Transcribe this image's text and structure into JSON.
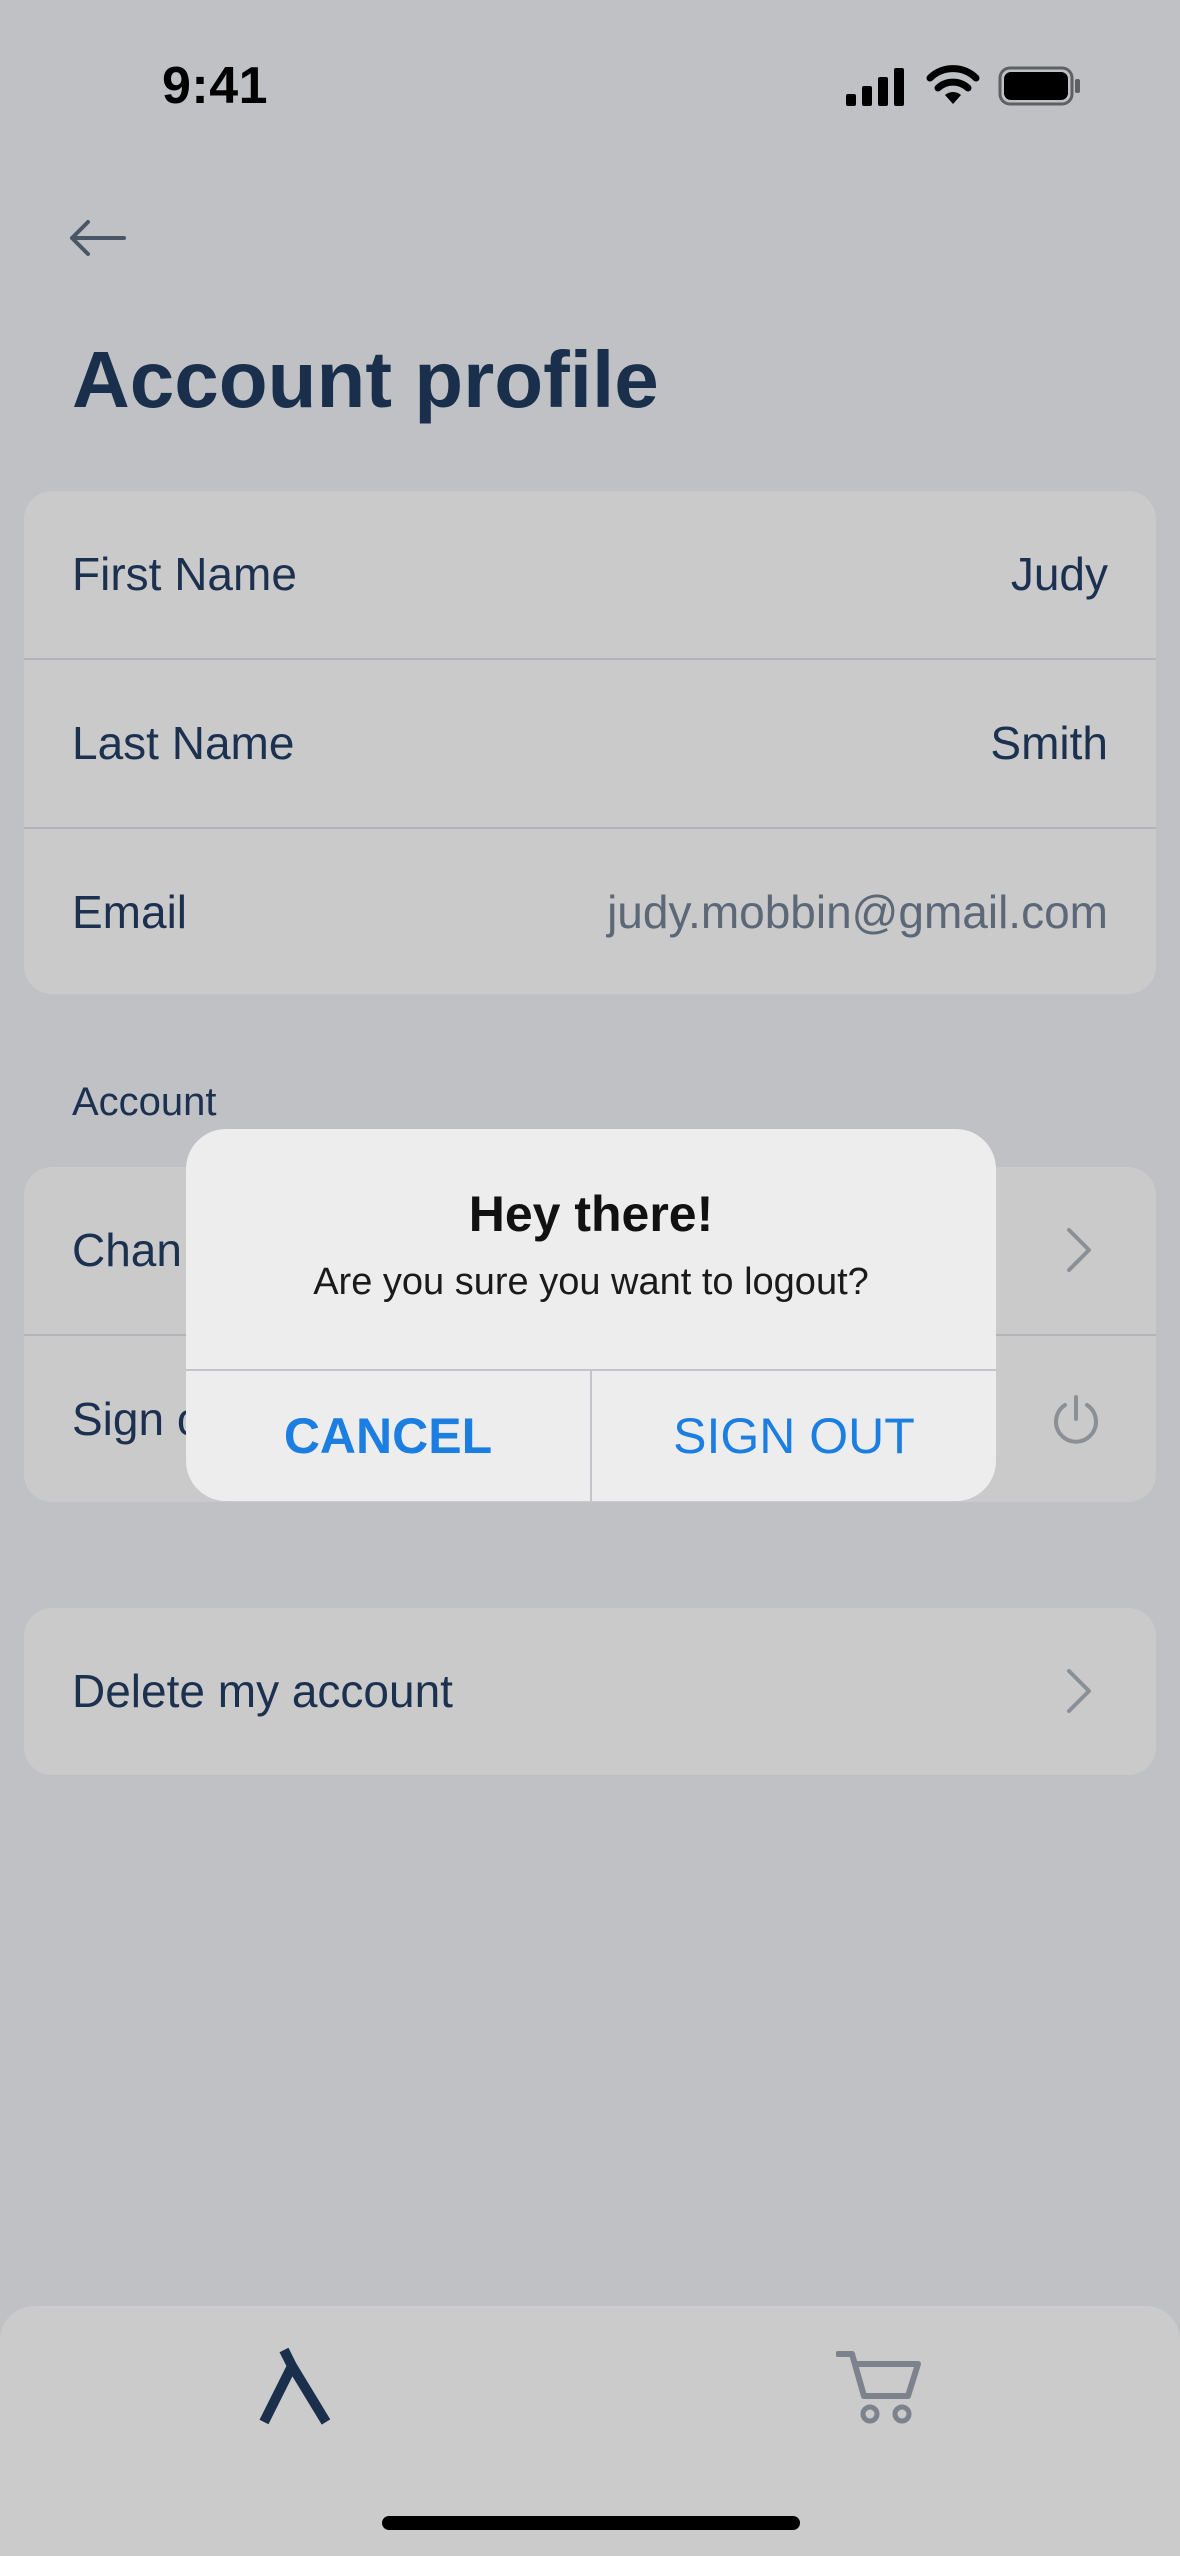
{
  "status_bar": {
    "time": "9:41",
    "icons": [
      "cellular-signal-icon",
      "wifi-icon",
      "battery-icon"
    ]
  },
  "header": {
    "back_icon": "arrow-left-icon",
    "title": "Account profile"
  },
  "profile": {
    "first_name_label": "First Name",
    "first_name_value": "Judy",
    "last_name_label": "Last Name",
    "last_name_value": "Smith",
    "email_label": "Email",
    "email_value": "judy.mobbin@gmail.com"
  },
  "account_section": {
    "label": "Account",
    "change_password_label": "Chan",
    "sign_out_label": "Sign o",
    "sign_out_icon": "power-icon",
    "chevron_icon": "chevron-right-icon"
  },
  "delete_section": {
    "delete_label": "Delete my account",
    "chevron_icon": "chevron-right-icon"
  },
  "dialog": {
    "title": "Hey there!",
    "message": "Are you sure you want to logout?",
    "cancel_label": "CANCEL",
    "sign_out_label": "SIGN OUT"
  },
  "tab_bar": {
    "items": [
      "lambda-icon",
      "cart-icon"
    ]
  },
  "colors": {
    "background": "#bfc1c5",
    "card": "#cacacb",
    "text_primary": "#1c3150",
    "text_muted": "#5c6878",
    "accent": "#1b7ee0"
  }
}
